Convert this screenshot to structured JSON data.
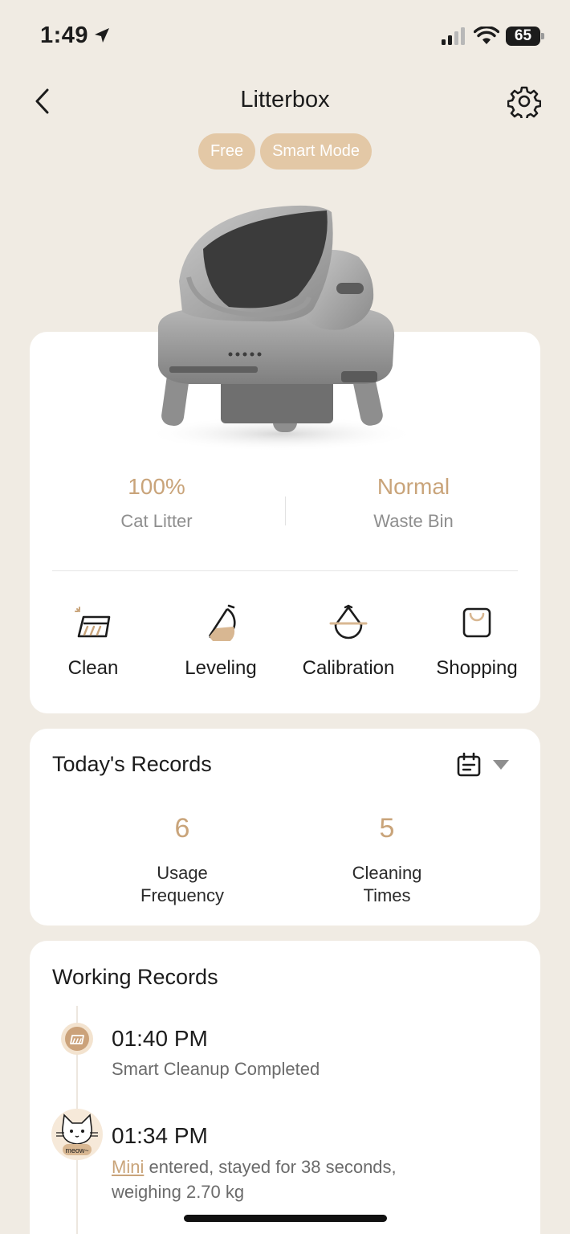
{
  "status_bar": {
    "time": "1:49",
    "battery": "65"
  },
  "header": {
    "title": "Litterbox",
    "tags": [
      "Free",
      "Smart Mode"
    ]
  },
  "device": {
    "stats": [
      {
        "value": "100%",
        "label": "Cat Litter"
      },
      {
        "value": "Normal",
        "label": "Waste Bin"
      }
    ],
    "actions": [
      {
        "label": "Clean",
        "icon": "broom-icon"
      },
      {
        "label": "Leveling",
        "icon": "leveling-icon"
      },
      {
        "label": "Calibration",
        "icon": "calibration-icon"
      },
      {
        "label": "Shopping",
        "icon": "shopping-bag-icon"
      }
    ]
  },
  "todays_records": {
    "title": "Today's Records",
    "items": [
      {
        "value": "6",
        "label_line1": "Usage",
        "label_line2": "Frequency"
      },
      {
        "value": "5",
        "label_line1": "Cleaning",
        "label_line2": "Times"
      }
    ]
  },
  "working_records": {
    "title": "Working Records",
    "entries": [
      {
        "time": "01:40 PM",
        "description": "Smart Cleanup Completed"
      },
      {
        "time": "01:34 PM",
        "cat_name": "Mini",
        "description_line1": " entered, stayed for 38 seconds,",
        "description_line2": "weighing  2.70 kg",
        "avatar_text": "meow~"
      }
    ]
  },
  "colors": {
    "background": "#f0ebe3",
    "accent": "#c9a47a",
    "tag": "#e3c8a6"
  }
}
